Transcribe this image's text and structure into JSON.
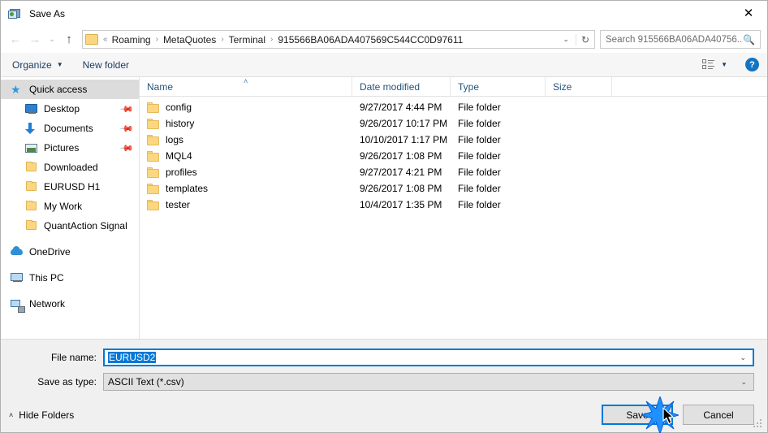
{
  "window": {
    "title": "Save As",
    "app_icon": "save-as-icon",
    "close_label": "✕"
  },
  "nav": {
    "back_icon": "←",
    "forward_icon": "→",
    "recent_icon": "⌄",
    "up_icon": "↑",
    "folder_icon": "folder-icon",
    "breadcrumb_prefix": "«",
    "breadcrumbs": [
      "Roaming",
      "MetaQuotes",
      "Terminal",
      "915566BA06ADA407569C544CC0D97611"
    ],
    "separator": "›",
    "dropdown_icon": "⌄",
    "refresh_icon": "↻"
  },
  "search": {
    "placeholder": "Search 915566BA06ADA40756...",
    "icon": "search-icon"
  },
  "toolbar": {
    "organize_label": "Organize",
    "organize_caret": "▼",
    "new_folder_label": "New folder",
    "view_icon": "view-layout-icon",
    "view_caret": "▼",
    "help_label": "?"
  },
  "sidebar": {
    "items": [
      {
        "label": "Quick access",
        "icon": "star-icon",
        "level": 0,
        "selected": true,
        "pinned": false
      },
      {
        "label": "Desktop",
        "icon": "desktop-icon",
        "level": 1,
        "selected": false,
        "pinned": true
      },
      {
        "label": "Documents",
        "icon": "documents-icon",
        "level": 1,
        "selected": false,
        "pinned": true
      },
      {
        "label": "Pictures",
        "icon": "pictures-icon",
        "level": 1,
        "selected": false,
        "pinned": true
      },
      {
        "label": "Downloaded",
        "icon": "folder-icon",
        "level": 1,
        "selected": false,
        "pinned": false
      },
      {
        "label": "EURUSD H1",
        "icon": "folder-icon",
        "level": 1,
        "selected": false,
        "pinned": false
      },
      {
        "label": "My Work",
        "icon": "folder-icon",
        "level": 1,
        "selected": false,
        "pinned": false
      },
      {
        "label": "QuantAction Signal",
        "icon": "folder-icon",
        "level": 1,
        "selected": false,
        "pinned": false
      },
      {
        "label": "OneDrive",
        "icon": "cloud-icon",
        "level": 0,
        "selected": false,
        "pinned": false
      },
      {
        "label": "This PC",
        "icon": "pc-icon",
        "level": 0,
        "selected": false,
        "pinned": false
      },
      {
        "label": "Network",
        "icon": "network-icon",
        "level": 0,
        "selected": false,
        "pinned": false
      }
    ],
    "pin_icon": "✒"
  },
  "filelist": {
    "columns": [
      "Name",
      "Date modified",
      "Type",
      "Size"
    ],
    "sort_caret": "˄",
    "rows": [
      {
        "name": "config",
        "date": "9/27/2017 4:44 PM",
        "type": "File folder",
        "size": ""
      },
      {
        "name": "history",
        "date": "9/26/2017 10:17 PM",
        "type": "File folder",
        "size": ""
      },
      {
        "name": "logs",
        "date": "10/10/2017 1:17 PM",
        "type": "File folder",
        "size": ""
      },
      {
        "name": "MQL4",
        "date": "9/26/2017 1:08 PM",
        "type": "File folder",
        "size": ""
      },
      {
        "name": "profiles",
        "date": "9/27/2017 4:21 PM",
        "type": "File folder",
        "size": ""
      },
      {
        "name": "templates",
        "date": "9/26/2017 1:08 PM",
        "type": "File folder",
        "size": ""
      },
      {
        "name": "tester",
        "date": "10/4/2017 1:35 PM",
        "type": "File folder",
        "size": ""
      }
    ]
  },
  "form": {
    "filename_label": "File name:",
    "filename_value": "EURUSD2",
    "filetype_label": "Save as type:",
    "filetype_value": "ASCII Text (*.csv)",
    "combo_arrow": "⌄"
  },
  "footer": {
    "hide_folders_label": "Hide Folders",
    "hide_folders_caret": "˄",
    "save_label": "Save",
    "cancel_label": "Cancel"
  },
  "colors": {
    "accent": "#0078d7",
    "folder": "#fcd77f",
    "header_text": "#25557e",
    "selection": "#0078d7",
    "sidebar_selected": "#dcdcdc",
    "help_blue": "#1275c4"
  }
}
